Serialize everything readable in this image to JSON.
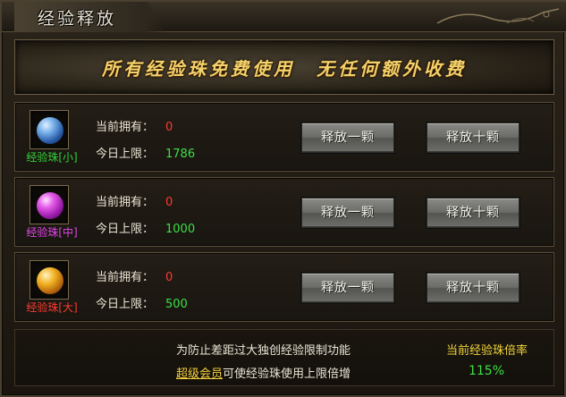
{
  "window": {
    "title": "经验释放"
  },
  "banner": {
    "text": "所有经验珠免费使用　无任何额外收费"
  },
  "labels": {
    "owned": "当前拥有：",
    "limit": "今日上限："
  },
  "buttons": {
    "release_one": "释放一颗",
    "release_ten": "释放十颗"
  },
  "beads": [
    {
      "name": "经验珠[小]",
      "owned": "0",
      "limit": "1786",
      "icon": "orb-blue-icon",
      "label_color": "#34d23a"
    },
    {
      "name": "经验珠[中]",
      "owned": "0",
      "limit": "1000",
      "icon": "orb-purple-icon",
      "label_color": "#e046e8"
    },
    {
      "name": "经验珠[大]",
      "owned": "0",
      "limit": "500",
      "icon": "orb-gold-icon",
      "label_color": "#ff3b2e"
    }
  ],
  "footer": {
    "line1": "为防止差距过大独创经验限制功能",
    "vip_link": "超级会员",
    "line2_rest": "可使经验珠使用上限倍增",
    "rate_label": "当前经验珠倍率",
    "rate_value": "115%"
  },
  "colors": {
    "value_red": "#ff3830",
    "value_green": "#3ce046",
    "banner_gold": "#f2d26a",
    "vip_yellow": "#f7d23c"
  }
}
